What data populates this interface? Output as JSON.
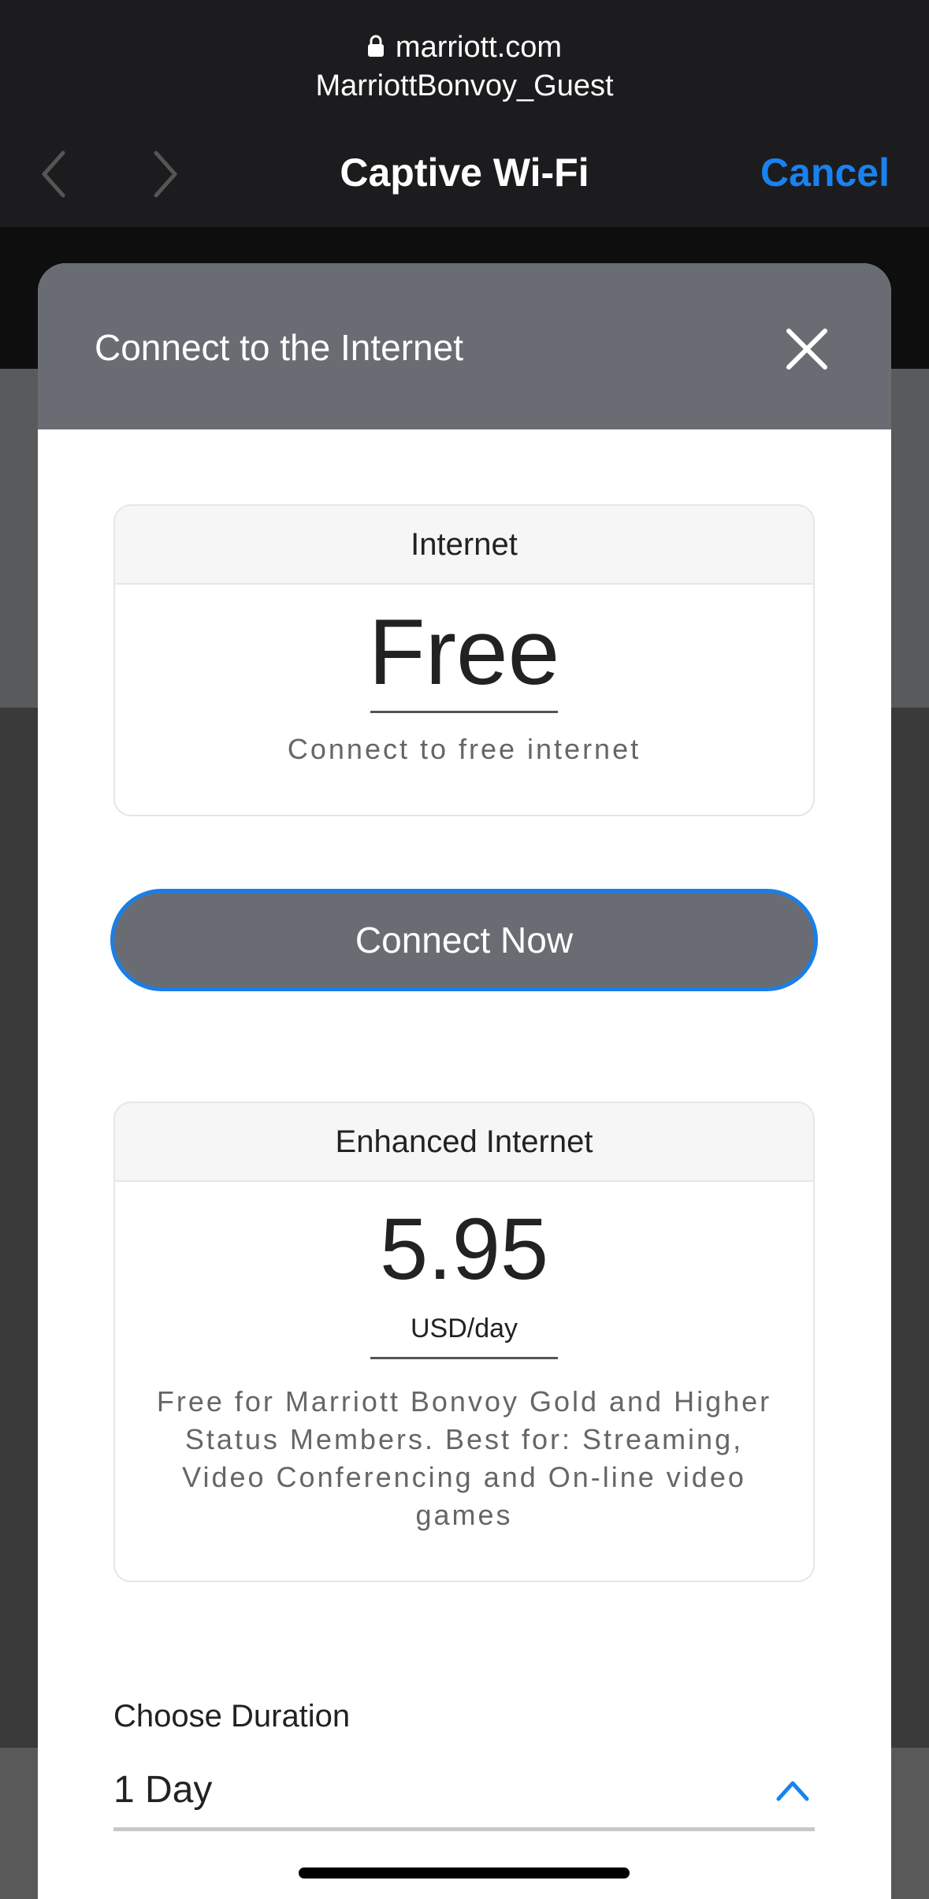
{
  "browser": {
    "domain": "marriott.com",
    "network_name": "MarriottBonvoy_Guest",
    "title": "Captive Wi-Fi",
    "cancel_label": "Cancel"
  },
  "sheet": {
    "title": "Connect to the Internet"
  },
  "plans": {
    "free": {
      "name": "Internet",
      "price": "Free",
      "description": "Connect to free internet"
    },
    "connect_button": "Connect Now",
    "enhanced": {
      "name": "Enhanced Internet",
      "price": "5.95",
      "unit": "USD/day",
      "description": "Free for Marriott Bonvoy Gold and Higher Status Members. Best for: Streaming, Video Conferencing and On-line video games"
    }
  },
  "duration": {
    "label": "Choose Duration",
    "selected": "1 Day"
  },
  "colors": {
    "accent": "#1a82f0",
    "header": "#696d73",
    "topbar": "#1c1c1e"
  }
}
